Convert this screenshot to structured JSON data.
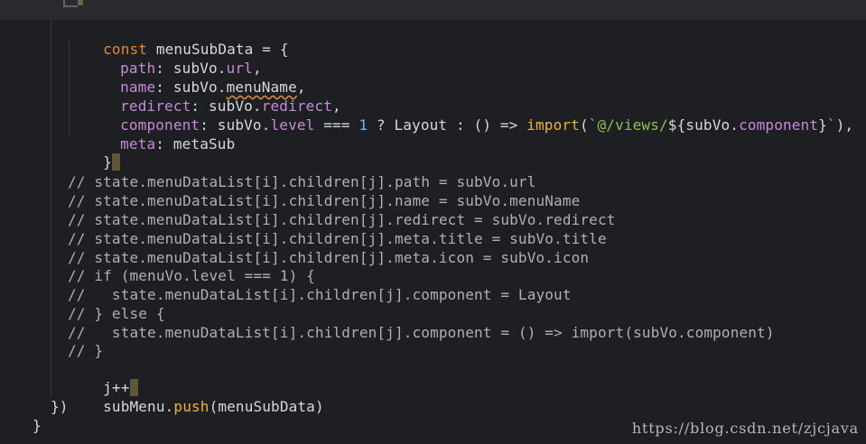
{
  "code": {
    "l1": {
      "kw": "const",
      "var": "menuSubData",
      "rest": " = {"
    },
    "l2": {
      "key": "path",
      "colon": ":",
      "obj": "subVo",
      "dot": ".",
      "prop": "url",
      "tail": ","
    },
    "l3": {
      "key": "name",
      "colon": ":",
      "obj": "subVo",
      "dot": ".",
      "prop": "menuName",
      "tail": ","
    },
    "l4": {
      "key": "redirect",
      "colon": ":",
      "obj": "subVo",
      "dot": ".",
      "prop": "redirect",
      "tail": ","
    },
    "l5": {
      "key": "component",
      "colon": ":",
      "obj": "subVo",
      "dot": ".",
      "prop": "level",
      "op": " === ",
      "num": "1",
      "tern": " ? Layout : () => ",
      "fn": "import",
      "open": "(",
      "str1": "`@/views/",
      "interp1": "${",
      "obj2": "subVo",
      "dot2": ".",
      "prop2": "component",
      "interp2": "}",
      "str2": "`",
      "close": "),"
    },
    "l6": {
      "key": "meta",
      "colon": ":",
      "val": "metaSub"
    },
    "l7": {
      "text": "}"
    },
    "comments": [
      "// state.menuDataList[i].children[j].path = subVo.url",
      "// state.menuDataList[i].children[j].name = subVo.menuName",
      "// state.menuDataList[i].children[j].redirect = subVo.redirect",
      "// state.menuDataList[i].children[j].meta.title = subVo.title",
      "// state.menuDataList[i].children[j].meta.icon = subVo.icon",
      "// if (menuVo.level === 1) {",
      "//   state.menuDataList[i].children[j].component = Layout",
      "// } else {",
      "//   state.menuDataList[i].children[j].component = () => import(subVo.component)",
      "// }"
    ],
    "l18": {
      "text": "j++"
    },
    "l19": {
      "obj": "subMenu",
      "dot": ".",
      "method": "push",
      "args": "(menuSubData)"
    },
    "l20": {
      "text": "})"
    },
    "l21": {
      "text": "}"
    }
  },
  "watermark": "https://blog.csdn.net/zjcjava",
  "colors": {
    "background": "#1e1f22",
    "keyword": "#e2873b",
    "property": "#c68ad8",
    "comment": "#aeb0b3",
    "number": "#6fb3ff",
    "string": "#8bc34a",
    "function": "#efb13e"
  }
}
